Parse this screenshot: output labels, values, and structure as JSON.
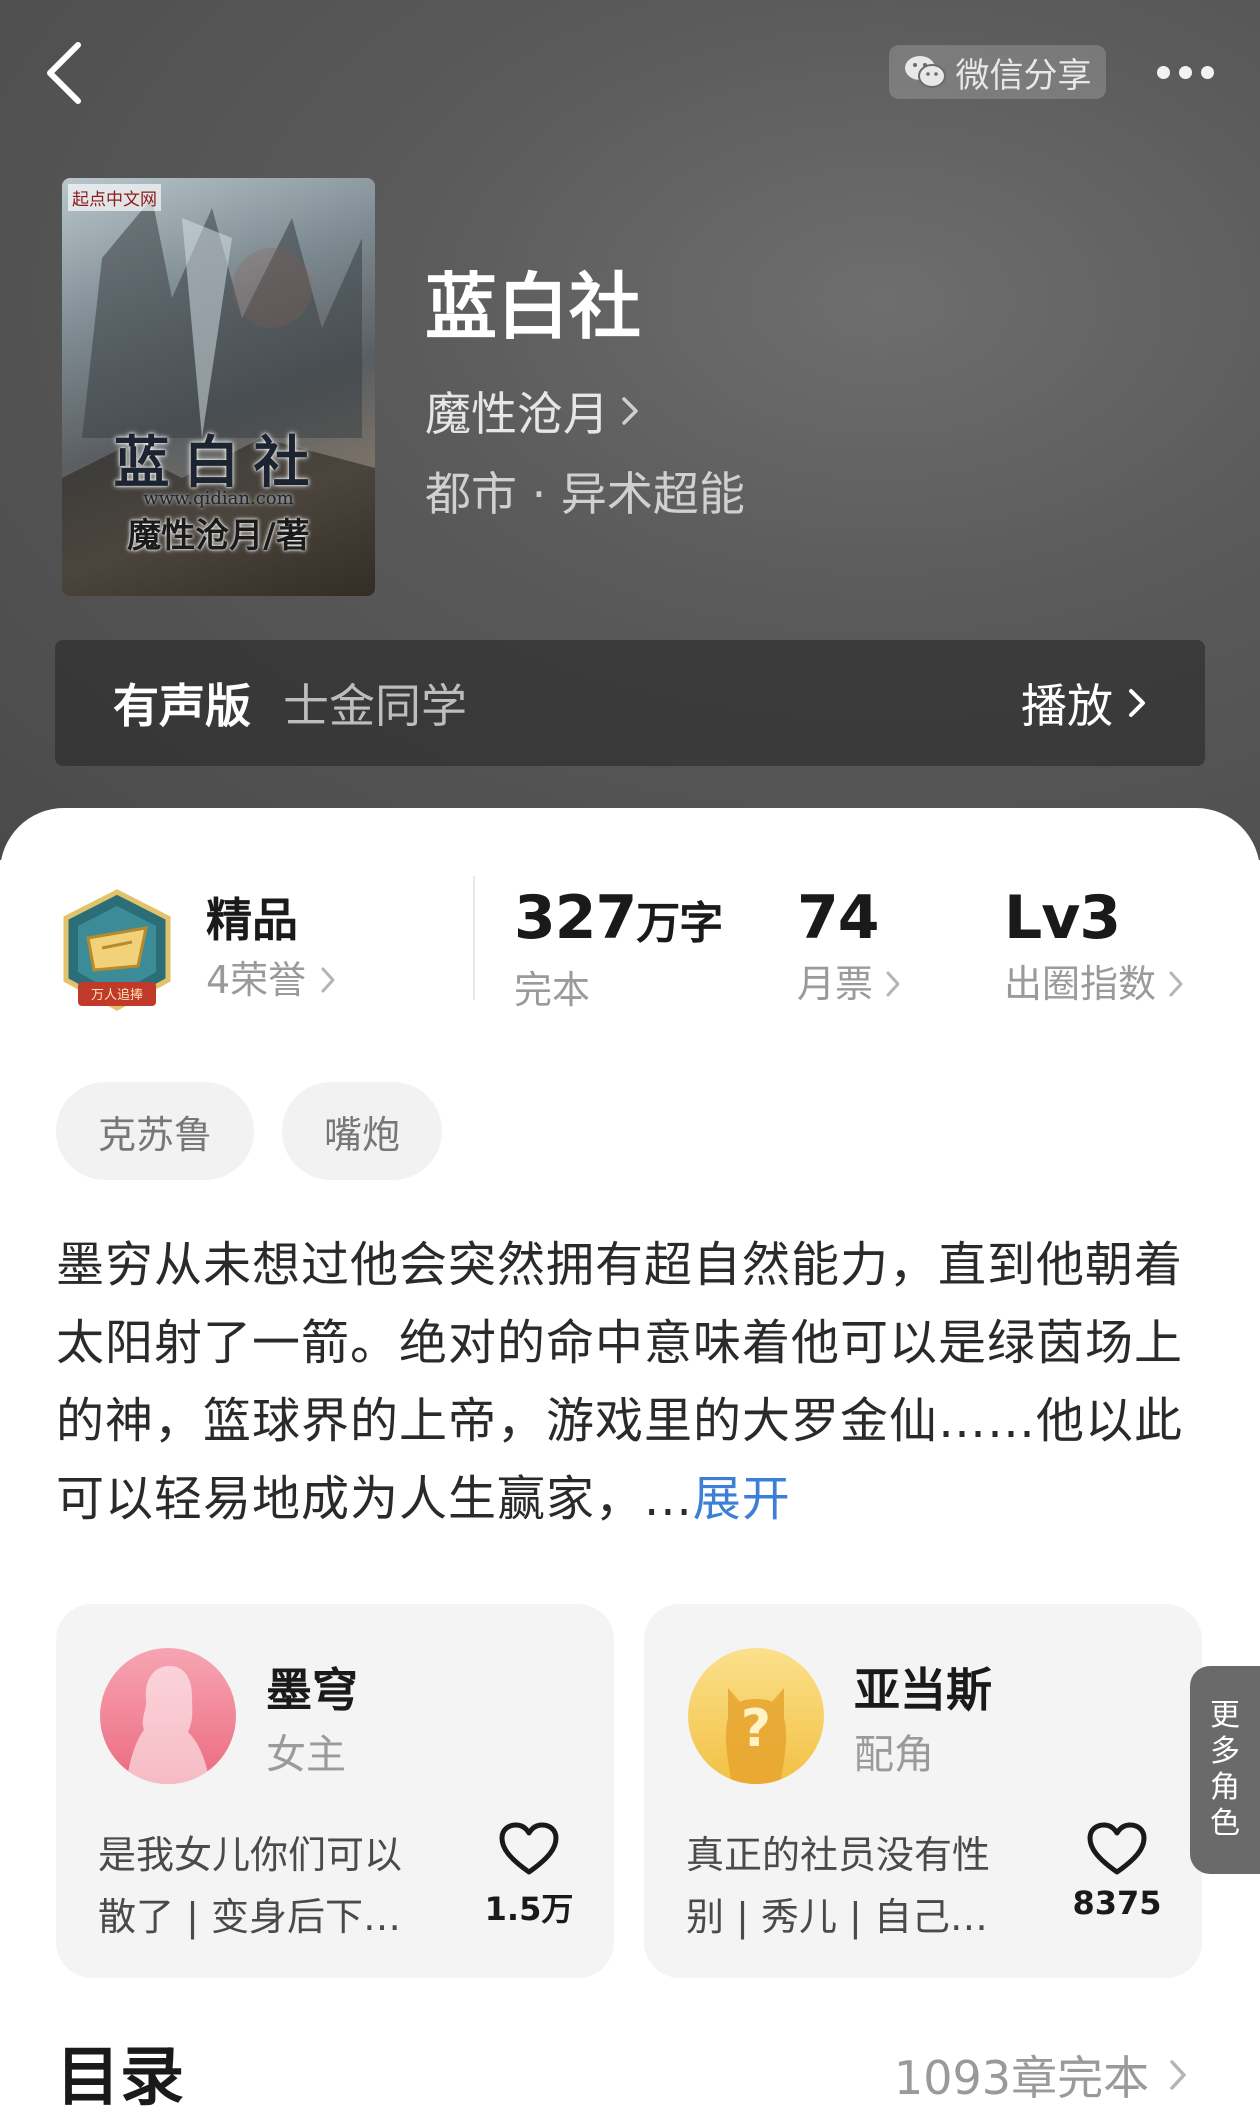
{
  "header": {
    "share_label": "微信分享"
  },
  "book": {
    "cover": {
      "publisher": "起点中文网",
      "title": "蓝白社",
      "url": "www.qidian.com",
      "author": "魔性沧月/著"
    },
    "title": "蓝白社",
    "author": "魔性沧月",
    "category": "都市 · 异术超能"
  },
  "audio": {
    "label": "有声版",
    "narrator": "士金同学",
    "play_label": "播放"
  },
  "honor": {
    "badge_text": "万人追捧",
    "title": "精品",
    "subtitle": "4荣誉"
  },
  "stats": {
    "words_value": "327",
    "words_unit": "万字",
    "words_label": "完本",
    "monthly_votes_value": "74",
    "monthly_votes_label": "月票",
    "index_value": "Lv3",
    "index_label": "出圈指数"
  },
  "tags": [
    "克苏鲁",
    "嘴炮"
  ],
  "synopsis": {
    "text": "墨穷从未想过他会突然拥有超自然能力，直到他朝着太阳射了一箭。绝对的命中意味着他可以是绿茵场上的神，篮球界的上帝，游戏里的大罗金仙……他以此可以轻易地成为人生赢家，...",
    "expand_label": "展开"
  },
  "roles": [
    {
      "name": "墨穹",
      "type": "女主",
      "description": "是我女儿你们可以散了 | 变身后下…",
      "likes": "1.5万",
      "avatar_color": "#f0788e"
    },
    {
      "name": "亚当斯",
      "type": "配角",
      "description": "真正的社员没有性别 | 秀儿 | 自己…",
      "likes": "8375",
      "avatar_color": "#f4c451"
    }
  ],
  "more_roles_label": [
    "更",
    "多",
    "角",
    "色"
  ],
  "toc": {
    "title": "目录",
    "info": "1093章完本"
  }
}
